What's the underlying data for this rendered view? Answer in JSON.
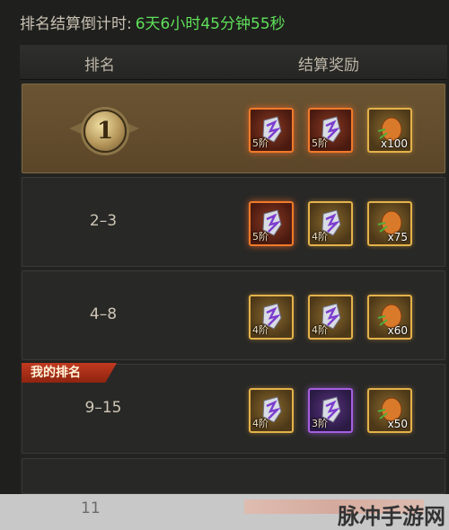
{
  "countdown": {
    "label": "排名结算倒计时:",
    "value": "6天6小时45分钟55秒"
  },
  "table": {
    "col_rank": "排名",
    "col_reward": "结算奖励",
    "rows": [
      {
        "rank": "1",
        "items": [
          {
            "icon": "crystal-shard-icon",
            "label": "5阶",
            "frame": "red"
          },
          {
            "icon": "crystal-shard-icon",
            "label": "5阶",
            "frame": "red"
          },
          {
            "icon": "orange-fruit-icon",
            "label": "x100",
            "frame": "gold"
          }
        ]
      },
      {
        "rank": "2–3",
        "items": [
          {
            "icon": "crystal-shard-icon",
            "label": "5阶",
            "frame": "red"
          },
          {
            "icon": "crystal-shard-icon",
            "label": "4阶",
            "frame": "gold"
          },
          {
            "icon": "orange-fruit-icon",
            "label": "x75",
            "frame": "gold"
          }
        ]
      },
      {
        "rank": "4–8",
        "items": [
          {
            "icon": "crystal-shard-icon",
            "label": "4阶",
            "frame": "gold"
          },
          {
            "icon": "crystal-shard-icon",
            "label": "4阶",
            "frame": "gold"
          },
          {
            "icon": "orange-fruit-icon",
            "label": "x60",
            "frame": "gold"
          }
        ]
      },
      {
        "rank": "9–15",
        "items": [
          {
            "icon": "crystal-shard-icon",
            "label": "4阶",
            "frame": "gold"
          },
          {
            "icon": "crystal-shard-icon",
            "label": "3阶",
            "frame": "purple"
          },
          {
            "icon": "orange-fruit-icon",
            "label": "x50",
            "frame": "gold"
          }
        ]
      }
    ]
  },
  "my_rank": {
    "tag": "我的排名",
    "value": "11"
  },
  "watermark": "脉冲手游网",
  "colors": {
    "countdown_value": "#5fe05a",
    "frame_gold": "#e3b24a",
    "frame_red": "#f07a2a",
    "frame_purple": "#a65ee0",
    "first_row_bg": "#6a5432"
  }
}
